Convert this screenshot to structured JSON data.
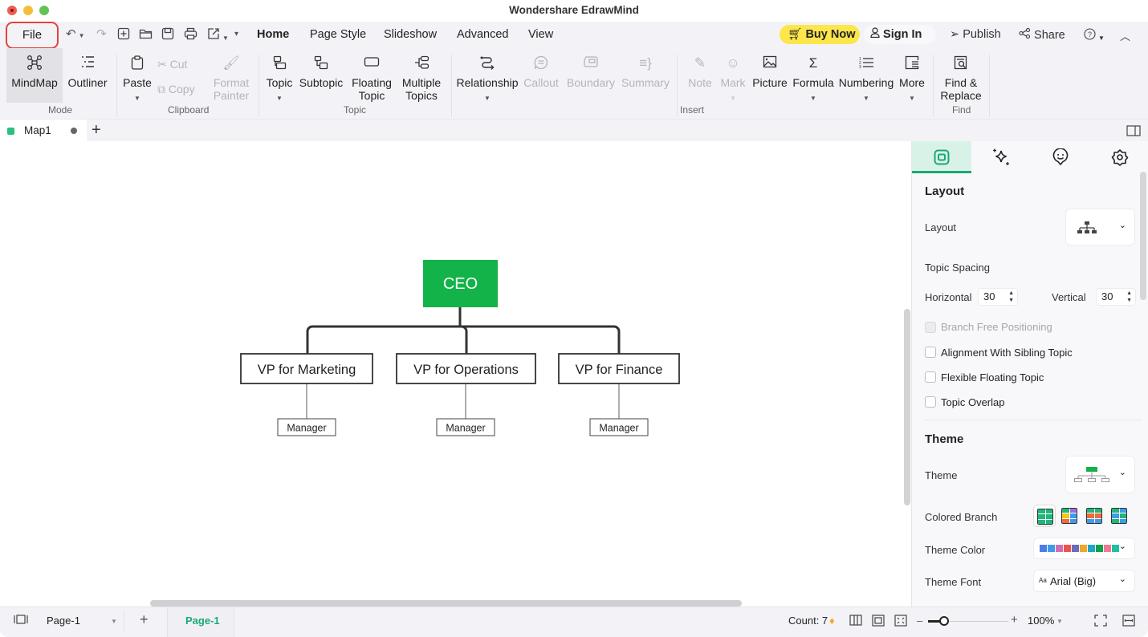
{
  "window": {
    "title": "Wondershare EdrawMind"
  },
  "menubar": {
    "file": "File",
    "tabs": [
      "Home",
      "Page Style",
      "Slideshow",
      "Advanced",
      "View"
    ],
    "active_tab": "Home",
    "buy_now": "Buy Now",
    "sign_in": "Sign In",
    "publish": "Publish",
    "share": "Share",
    "quick_access": [
      "undo-icon",
      "redo-icon",
      "new-icon",
      "open-folder-icon",
      "save-icon",
      "print-icon",
      "export-icon"
    ]
  },
  "ribbon": {
    "groups": {
      "mode": "Mode",
      "clipboard": "Clipboard",
      "topic": "Topic",
      "insert": "Insert",
      "find": "Find"
    },
    "mode": {
      "mindmap": "MindMap",
      "outliner": "Outliner"
    },
    "clipboard": {
      "paste": "Paste",
      "cut": "Cut",
      "copy": "Copy",
      "format_painter_1": "Format",
      "format_painter_2": "Painter"
    },
    "topic": {
      "topic": "Topic",
      "subtopic": "Subtopic",
      "floating_1": "Floating",
      "floating_2": "Topic",
      "multiple_1": "Multiple",
      "multiple_2": "Topics"
    },
    "insert": {
      "relationship": "Relationship",
      "callout": "Callout",
      "boundary": "Boundary",
      "summary": "Summary",
      "note": "Note",
      "mark": "Mark",
      "picture": "Picture",
      "formula": "Formula",
      "numbering": "Numbering",
      "more": "More"
    },
    "find": {
      "find_1": "Find &",
      "find_2": "Replace"
    }
  },
  "doc_tabs": [
    {
      "label": "Map1",
      "unsaved": true
    }
  ],
  "mindmap": {
    "root": {
      "label": "CEO",
      "color": "#14b34a"
    },
    "children": [
      {
        "label": "VP for Marketing",
        "child": "Manager"
      },
      {
        "label": "VP for Operations",
        "child": "Manager"
      },
      {
        "label": "VP for Finance",
        "child": "Manager"
      }
    ]
  },
  "panel": {
    "tabs": [
      "layout-tab",
      "style-ai-tab",
      "mark-tab",
      "settings-tab"
    ],
    "layout_section": "Layout",
    "layout_label": "Layout",
    "topic_spacing": "Topic Spacing",
    "horizontal_label": "Horizontal",
    "horizontal_value": "30",
    "vertical_label": "Vertical",
    "vertical_value": "30",
    "checkboxes": [
      {
        "label": "Branch Free Positioning",
        "checked": false,
        "disabled": true
      },
      {
        "label": "Alignment With Sibling Topic",
        "checked": false,
        "disabled": false
      },
      {
        "label": "Flexible Floating Topic",
        "checked": false,
        "disabled": false
      },
      {
        "label": "Topic Overlap",
        "checked": false,
        "disabled": false
      }
    ],
    "theme_section": "Theme",
    "theme_label": "Theme",
    "colored_branch_label": "Colored Branch",
    "theme_color_label": "Theme Color",
    "theme_colors": [
      "#4f7be8",
      "#3d9be9",
      "#cf6fb0",
      "#ef5350",
      "#6a6cb8",
      "#f5a623",
      "#1ea7c5",
      "#13a04a",
      "#ef7a94",
      "#1fbfa3"
    ],
    "theme_font_label": "Theme Font",
    "theme_font_value": "Arial (Big)"
  },
  "statusbar": {
    "page_select": "Page-1",
    "page_tab": "Page-1",
    "count": "Count: 7",
    "zoom": "100%",
    "zoom_fraction": 0.2
  },
  "colors": {
    "accent": "#1aa876",
    "highlight": "#e5413a",
    "buy": "#fce64b"
  }
}
